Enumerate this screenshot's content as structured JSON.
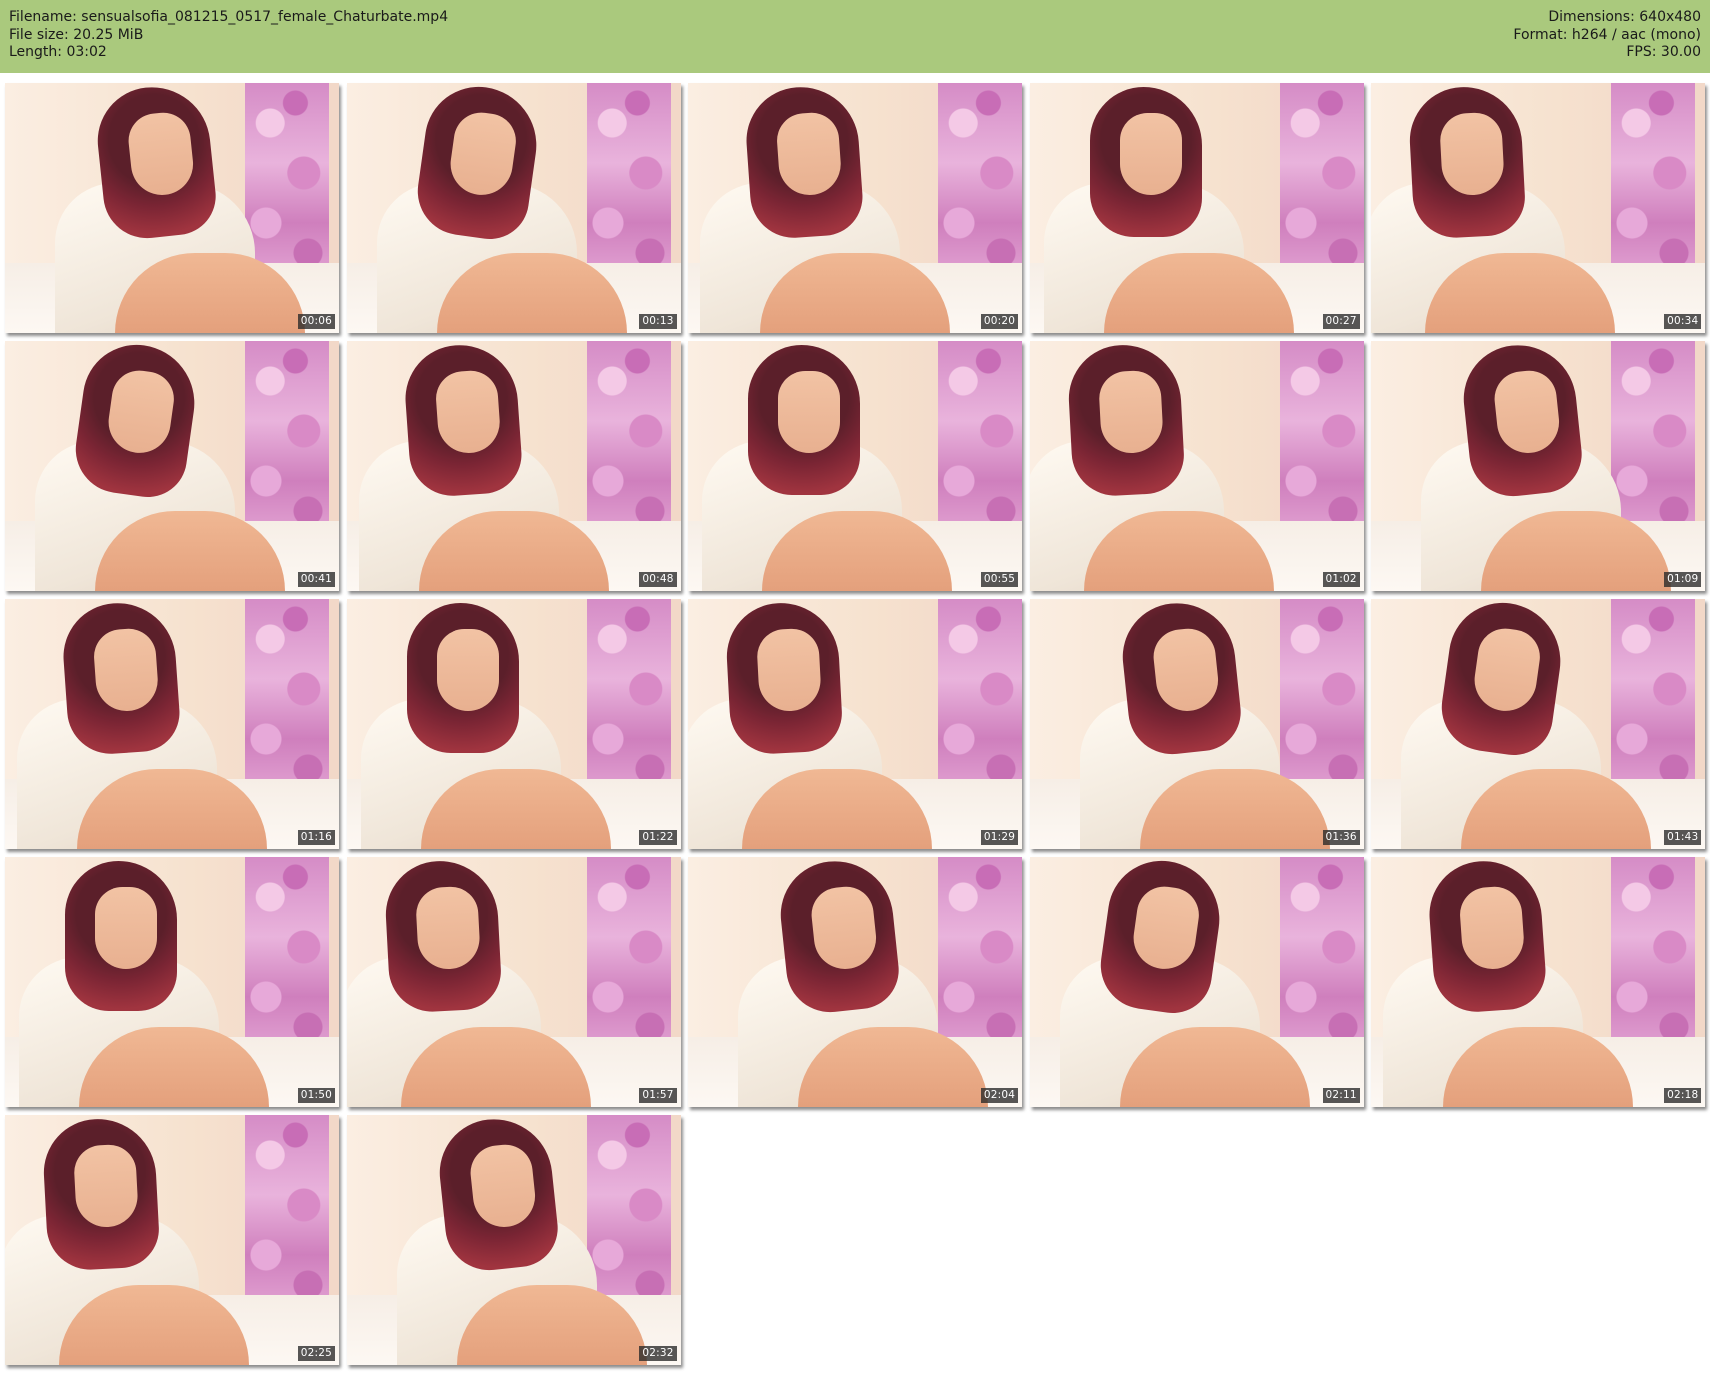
{
  "header": {
    "filename_line": "Filename: sensualsofia_081215_0517_female_Chaturbate.mp4",
    "filesize_line": "File size: 20.25 MiB",
    "length_line": "Length: 03:02",
    "dimensions_line": "Dimensions: 640x480",
    "format_line": "Format: h264 / aac (mono)",
    "fps_line": "FPS: 30.00"
  },
  "colors": {
    "header_background": "#aac97d",
    "page_background": "#ffffff"
  },
  "thumbnails": [
    {
      "timestamp": "00:06"
    },
    {
      "timestamp": "00:13"
    },
    {
      "timestamp": "00:20"
    },
    {
      "timestamp": "00:27"
    },
    {
      "timestamp": "00:34"
    },
    {
      "timestamp": "00:41"
    },
    {
      "timestamp": "00:48"
    },
    {
      "timestamp": "00:55"
    },
    {
      "timestamp": "01:02"
    },
    {
      "timestamp": "01:09"
    },
    {
      "timestamp": "01:16"
    },
    {
      "timestamp": "01:22"
    },
    {
      "timestamp": "01:29"
    },
    {
      "timestamp": "01:36"
    },
    {
      "timestamp": "01:43"
    },
    {
      "timestamp": "01:50"
    },
    {
      "timestamp": "01:57"
    },
    {
      "timestamp": "02:04"
    },
    {
      "timestamp": "02:11"
    },
    {
      "timestamp": "02:18"
    },
    {
      "timestamp": "02:25"
    },
    {
      "timestamp": "02:32"
    }
  ]
}
